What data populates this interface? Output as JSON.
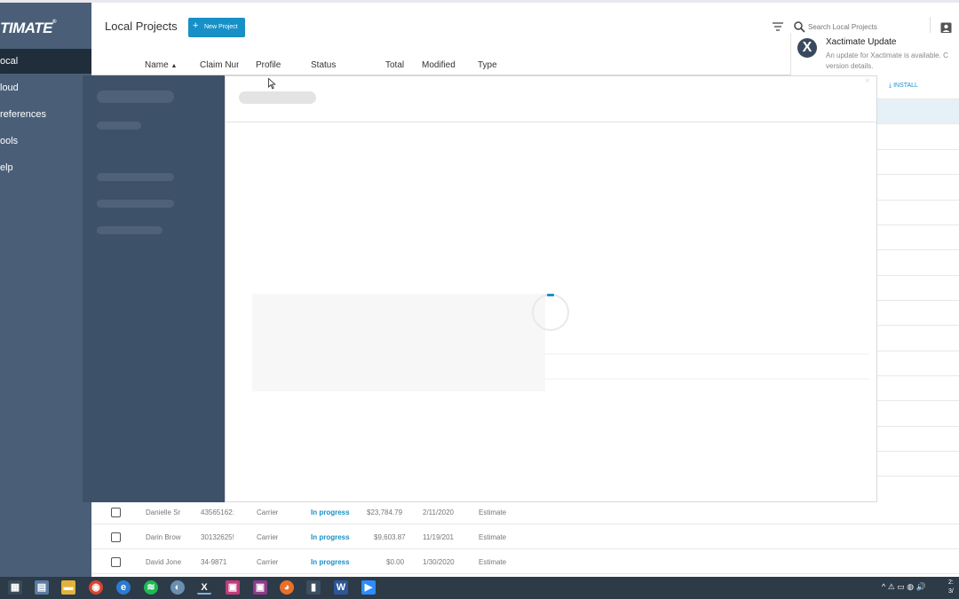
{
  "app": {
    "logo_text": "TIMATE",
    "logo_mark": "®"
  },
  "sidebar": {
    "items": [
      {
        "label": "ocal",
        "active": true
      },
      {
        "label": "loud",
        "active": false
      },
      {
        "label": "references",
        "active": false
      },
      {
        "label": "ools",
        "active": false
      },
      {
        "label": "elp",
        "active": false
      }
    ]
  },
  "header": {
    "title": "Local Projects",
    "new_project_label": "New Project",
    "search_placeholder": "Search Local Projects",
    "columns": [
      "Name",
      "Claim Num",
      "Profile",
      "Status",
      "Total",
      "Modified",
      "Type"
    ],
    "sort_indicator": "▲"
  },
  "notification": {
    "title": "Xactimate Update",
    "body_line1": "An update for Xactimate is available. C",
    "body_line2": "version details.",
    "install_label": "INSTALL",
    "icon_letter": "X"
  },
  "table": {
    "rows": [
      {
        "name": "Danielle Sr",
        "claim": "43565162:",
        "profile": "Carrier",
        "status": "In progress",
        "total": "$23,784.79",
        "modified": "2/11/2020",
        "type": "Estimate"
      },
      {
        "name": "Darin Brow",
        "claim": "30132625!",
        "profile": "Carrier",
        "status": "In progress",
        "total": "$9,603.87",
        "modified": "11/19/201",
        "type": "Estimate"
      },
      {
        "name": "David Jone",
        "claim": "34-9871",
        "profile": "Carrier",
        "status": "In progress",
        "total": "$0.00",
        "modified": "1/30/2020",
        "type": "Estimate"
      }
    ]
  },
  "modal": {
    "loading": true,
    "close_glyph": "×"
  },
  "taskbar": {
    "icons": [
      "calculator-icon",
      "notepad-icon",
      "file-explorer-icon",
      "chrome-icon",
      "edge-icon",
      "spotify-icon",
      "paint-icon",
      "xactimate-icon",
      "app-icon-1",
      "app-icon-2",
      "firefox-icon",
      "chart-app-icon",
      "word-icon",
      "zoom-icon"
    ],
    "tray_text": "^ ⚠ ▭ ◍ 🔊",
    "clock_line1": "2:",
    "clock_line2": "3/"
  },
  "colors": {
    "accent": "#1790c7",
    "sidebar": "#4a5f77",
    "sidebar_active": "#202d3b"
  }
}
